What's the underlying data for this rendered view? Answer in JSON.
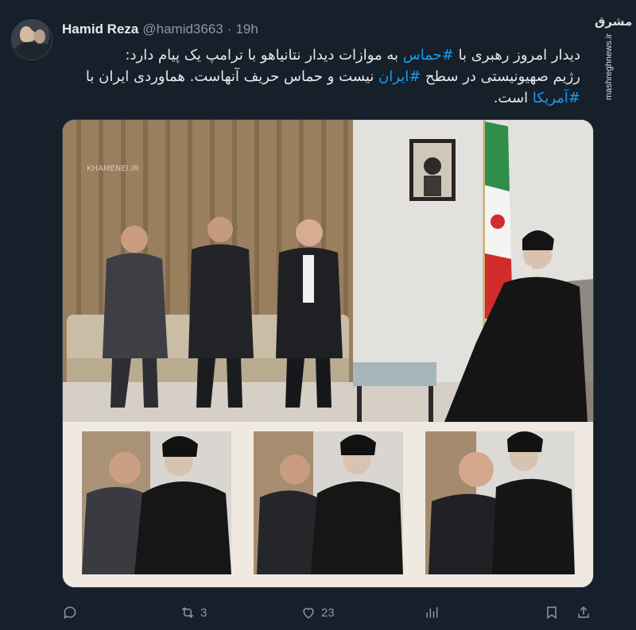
{
  "tweet": {
    "author_name": "Hamid Reza",
    "author_handle": "@hamid3663",
    "separator": "·",
    "time": "19h",
    "text_parts": [
      {
        "t": "دیدار امروز رهبری با ",
        "tag": false
      },
      {
        "t": "#حماس",
        "tag": true
      },
      {
        "t": " به موازات دیدار نتانیاهو با ترامپ یک پیام دارد:",
        "tag": false
      },
      {
        "t": "\n",
        "tag": false
      },
      {
        "t": "رژیم صهیونیستی در سطح ",
        "tag": false
      },
      {
        "t": "#ایران",
        "tag": true
      },
      {
        "t": " نیست و حماس حریف آنهاست. هماوردی ایران با",
        "tag": false
      },
      {
        "t": "\n",
        "tag": false
      },
      {
        "t": "#آمریکا",
        "tag": true
      },
      {
        "t": " است.",
        "tag": false
      }
    ],
    "media_watermark": "KHAMENEI.IR"
  },
  "watermark": {
    "logo": "مشرق",
    "url": "mashreghnews.ir"
  },
  "actions": {
    "reply_icon": "reply-icon",
    "retweet_count": "3",
    "like_count": "23",
    "views_icon": "views-icon",
    "bookmark_icon": "bookmark-icon",
    "share_icon": "share-icon"
  },
  "colors": {
    "background": "#15202b",
    "text": "#e7e9ea",
    "secondary": "#8b98a5",
    "accent": "#1d9bf0"
  }
}
